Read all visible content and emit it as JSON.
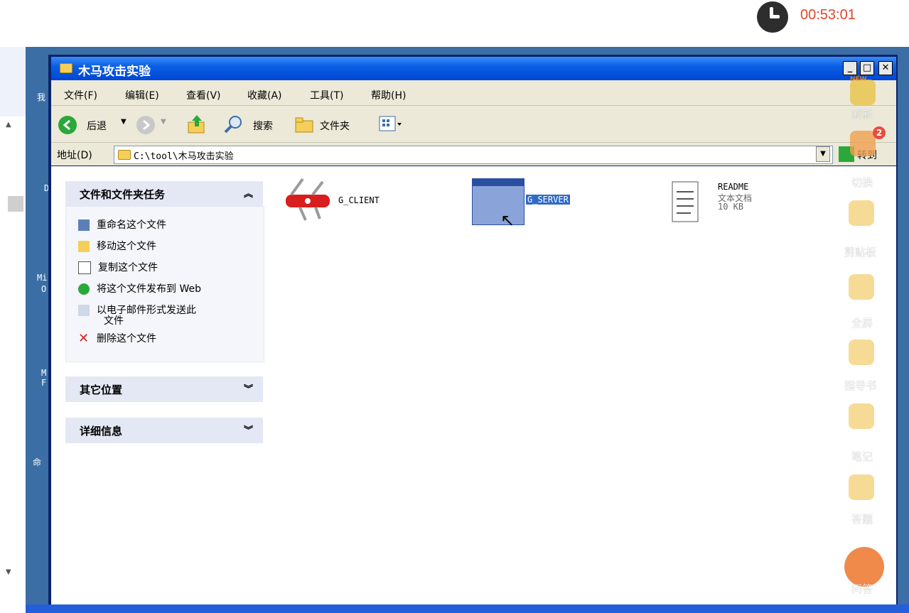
{
  "timer": {
    "text": "00:53:01"
  },
  "desktop": {
    "labels": [
      "我",
      "D",
      "Mi",
      "O",
      "M",
      "F",
      "命"
    ]
  },
  "window": {
    "title": "木马攻击实验",
    "controls": {
      "minimize": "_",
      "maximize": "□",
      "close": "✕"
    }
  },
  "menu": {
    "file": "文件(F)",
    "edit": "编辑(E)",
    "view": "查看(V)",
    "favorites": "收藏(A)",
    "tools": "工具(T)",
    "help": "帮助(H)"
  },
  "toolbar": {
    "back": "后退",
    "search": "搜索",
    "folders": "文件夹"
  },
  "address": {
    "label": "地址(D)",
    "value": "C:\\tool\\木马攻击实验",
    "go": "转到"
  },
  "taskpane": {
    "file_tasks": {
      "title": "文件和文件夹任务",
      "items": [
        "重命名这个文件",
        "移动这个文件",
        "复制这个文件",
        "将这个文件发布到 Web",
        "以电子邮件形式发送此",
        "文件",
        "删除这个文件"
      ]
    },
    "other_places": {
      "title": "其它位置"
    },
    "details": {
      "title": "详细信息"
    }
  },
  "files": [
    {
      "name": "G_CLIENT",
      "icon": "swiss-knife-icon"
    },
    {
      "name": "G_SERVER",
      "icon": "app-window-icon",
      "selected": true
    },
    {
      "name": "README",
      "type": "文本文档",
      "size": "10 KB",
      "icon": "notepad-icon"
    }
  ],
  "rail": {
    "refresh": "刷新",
    "switch": "切换",
    "clipboard": "剪贴板",
    "fullscreen": "全屏",
    "guide": "指导书",
    "notes": "笔记",
    "answer": "答题",
    "ask": "问答",
    "badge": "2",
    "new_tag": "NEW"
  },
  "colors": {
    "titlebar": "#0a5fe4",
    "chrome": "#ece9d8",
    "desktop": "#3a6ea5",
    "timer": "#e0462b",
    "selection": "#316ac5"
  }
}
